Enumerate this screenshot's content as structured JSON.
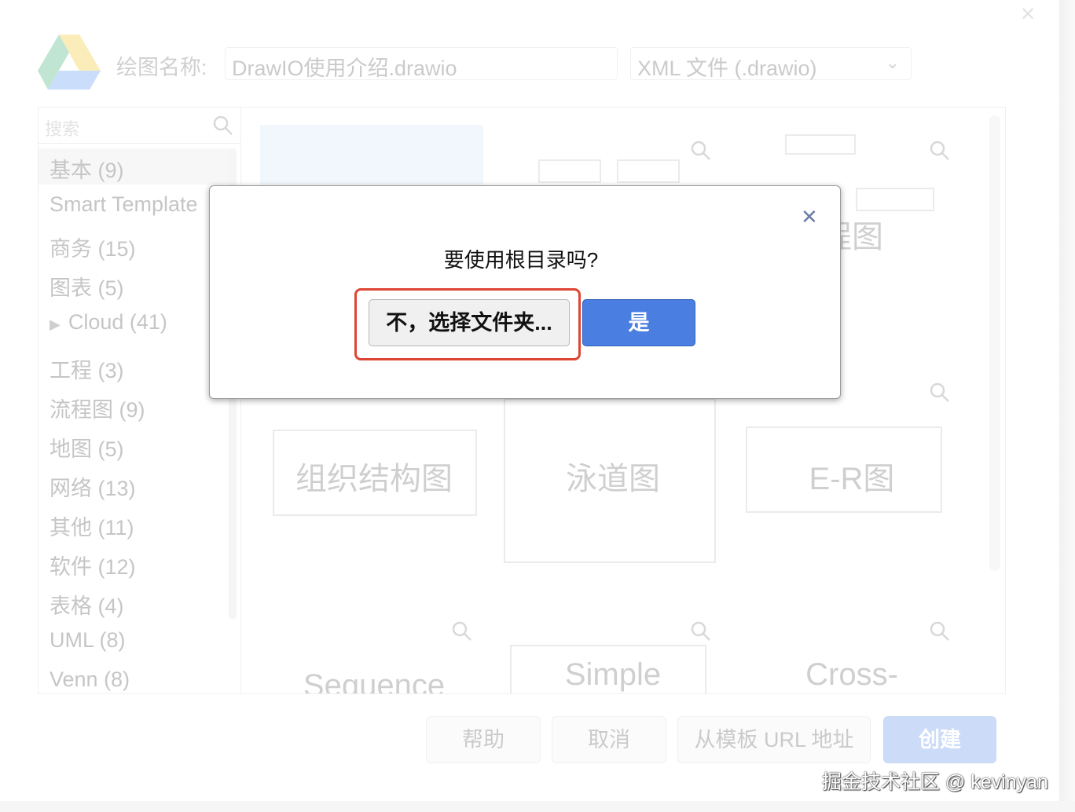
{
  "window": {
    "close_glyph": "✕"
  },
  "header": {
    "name_label": "绘图名称:",
    "name_value": "DrawIO使用介绍.drawio",
    "format_value": "XML 文件 (.drawio)",
    "format_icon": "chevron-down-icon"
  },
  "sidebar": {
    "search_placeholder": "搜索",
    "categories": [
      {
        "label": "基本 (9)"
      },
      {
        "label": "Smart Template"
      },
      {
        "label": "商务 (15)"
      },
      {
        "label": "图表 (5)"
      },
      {
        "label": "Cloud (41)"
      },
      {
        "label": "工程 (3)"
      },
      {
        "label": "流程图 (9)"
      },
      {
        "label": "地图 (5)"
      },
      {
        "label": "网络 (13)"
      },
      {
        "label": "其他 (11)"
      },
      {
        "label": "软件 (12)"
      },
      {
        "label": "表格 (4)"
      },
      {
        "label": "UML (8)"
      },
      {
        "label": "Venn (8)"
      }
    ]
  },
  "templates": [
    {
      "label": ""
    },
    {
      "label": ""
    },
    {
      "label": "程图"
    },
    {
      "label": "组织结构图"
    },
    {
      "label": "泳道图"
    },
    {
      "label": "E-R图"
    },
    {
      "label": "Sequence"
    },
    {
      "label": "Simple"
    },
    {
      "label": "Cross-"
    }
  ],
  "footer": {
    "help": "帮助",
    "cancel": "取消",
    "from_url": "从模板 URL 地址",
    "create": "创建"
  },
  "dialog": {
    "message": "要使用根目录吗?",
    "no_button": "不，选择文件夹...",
    "yes_button": "是",
    "close_glyph": "✕"
  },
  "watermark": "掘金技术社区 @ kevinyan",
  "colors": {
    "primary_blue": "#4a7ee0",
    "highlight_red": "#de4533"
  }
}
